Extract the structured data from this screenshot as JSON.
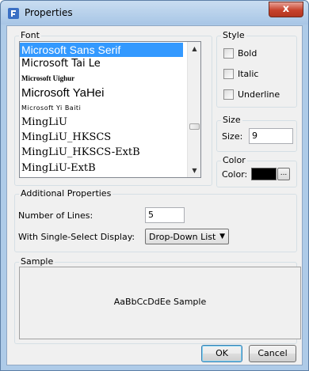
{
  "window": {
    "title": "Properties",
    "close_glyph": "x",
    "icon": "properties-icon"
  },
  "font_group": {
    "label": "Font",
    "fonts": [
      {
        "name": "Microsoft Sans Serif",
        "selected": true
      },
      {
        "name": "Microsoft Tai Le",
        "selected": false
      },
      {
        "name": "Microsoft Uighur",
        "selected": false
      },
      {
        "name": "Microsoft YaHei",
        "selected": false
      },
      {
        "name": "Microsoft Yi Baiti",
        "selected": false
      },
      {
        "name": "MingLiU",
        "selected": false
      },
      {
        "name": "MingLiU_HKSCS",
        "selected": false
      },
      {
        "name": "MingLiU_HKSCS-ExtB",
        "selected": false
      },
      {
        "name": "MingLiU-ExtB",
        "selected": false
      }
    ],
    "scroll_up": "▲",
    "scroll_down": "▼"
  },
  "style_group": {
    "label": "Style",
    "bold": {
      "label": "Bold",
      "checked": false
    },
    "italic": {
      "label": "Italic",
      "checked": false
    },
    "underline": {
      "label": "Underline",
      "checked": false
    }
  },
  "size_group": {
    "label": "Size",
    "field_label": "Size:",
    "value": "9"
  },
  "color_group": {
    "label": "Color",
    "field_label": "Color:",
    "value": "#000000",
    "picker_label": "..."
  },
  "additional_group": {
    "label": "Additional Properties",
    "lines_label": "Number of Lines:",
    "lines_value": "5",
    "display_label": "With Single-Select Display:",
    "display_value": "Drop-Down List",
    "display_arrow": "▼"
  },
  "sample_group": {
    "label": "Sample",
    "text": "AaBbCcDdEe Sample"
  },
  "buttons": {
    "ok": "OK",
    "cancel": "Cancel"
  },
  "colors": {
    "selection": "#3399ff",
    "title_bar": "#aecbe8",
    "close_button": "#c7422c"
  }
}
